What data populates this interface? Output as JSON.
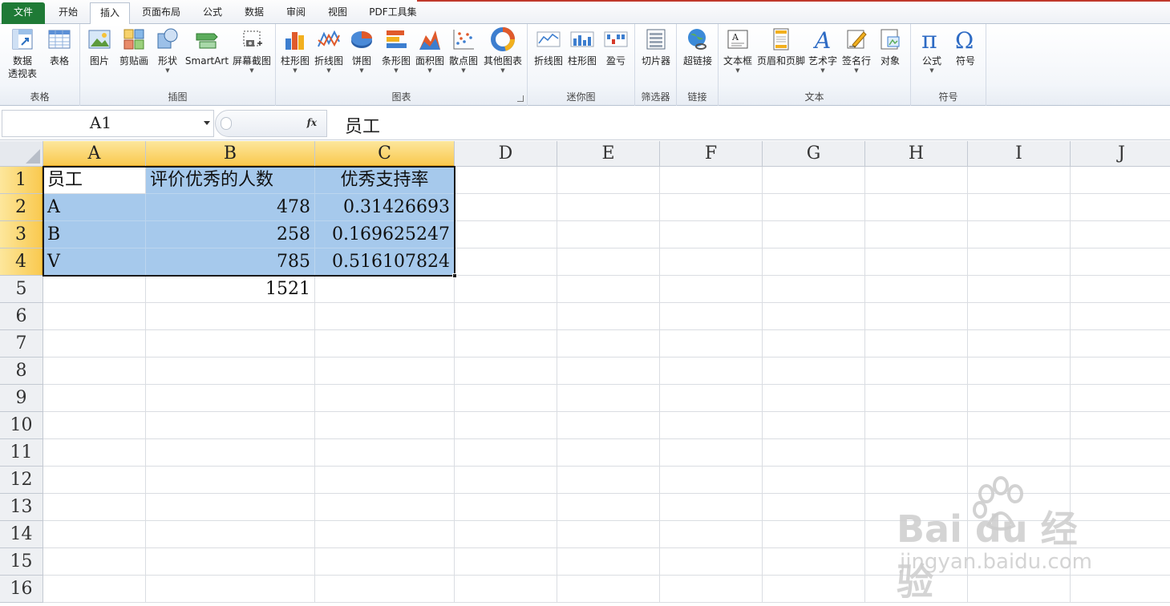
{
  "tabs": {
    "file": "文件",
    "items": [
      "开始",
      "插入",
      "页面布局",
      "公式",
      "数据",
      "审阅",
      "视图",
      "PDF工具集"
    ],
    "active_index": 1
  },
  "ribbon": {
    "groups": {
      "table": "表格",
      "illustrations": "插图",
      "charts": "图表",
      "sparklines": "迷你图",
      "filter": "筛选器",
      "links": "链接",
      "text": "文本",
      "symbols": "符号"
    },
    "buttons": {
      "pivot_line1": "数据",
      "pivot_line2": "透视表",
      "table": "表格",
      "picture": "图片",
      "clipart": "剪贴画",
      "shapes": "形状",
      "smartart": "SmartArt",
      "screenshot": "屏幕截图",
      "column_chart": "柱形图",
      "line_chart": "折线图",
      "pie_chart": "饼图",
      "bar_chart": "条形图",
      "area_chart": "面积图",
      "scatter_chart": "散点图",
      "other_charts": "其他图表",
      "spark_line": "折线图",
      "spark_column": "柱形图",
      "spark_winloss": "盈亏",
      "slicer": "切片器",
      "hyperlink": "超链接",
      "textbox": "文本框",
      "header_footer": "页眉和页脚",
      "wordart": "艺术字",
      "signature": "签名行",
      "object": "对象",
      "equation": "公式",
      "symbol": "符号"
    }
  },
  "formula_bar": {
    "name_box": "A1",
    "fx_label": "fx",
    "content": "员工"
  },
  "sheet": {
    "columns": [
      "A",
      "B",
      "C",
      "D",
      "E",
      "F",
      "G",
      "H",
      "I",
      "J"
    ],
    "rows": [
      "1",
      "2",
      "3",
      "4",
      "5",
      "6",
      "7",
      "8",
      "9",
      "10",
      "11",
      "12",
      "13",
      "14",
      "15",
      "16"
    ],
    "cells": {
      "A1": "员工",
      "B1": "评价优秀的人数",
      "C1": "优秀支持率",
      "A2": "A",
      "B2": "478",
      "C2": "0.31426693",
      "A3": "B",
      "B3": "258",
      "C3": "0.169625247",
      "A4": "V",
      "B4": "785",
      "C4": "0.516107824",
      "B5": "1521"
    },
    "selection": "A1:C4",
    "selection_color": "#a6c9ec",
    "header_highlight": "#f9c94f"
  },
  "watermark": {
    "brand": "Bai du 经验",
    "url": "jingyan.baidu.com"
  },
  "colors": {
    "file_tab": "#1f7a36",
    "accent_red": "#c0392b"
  }
}
